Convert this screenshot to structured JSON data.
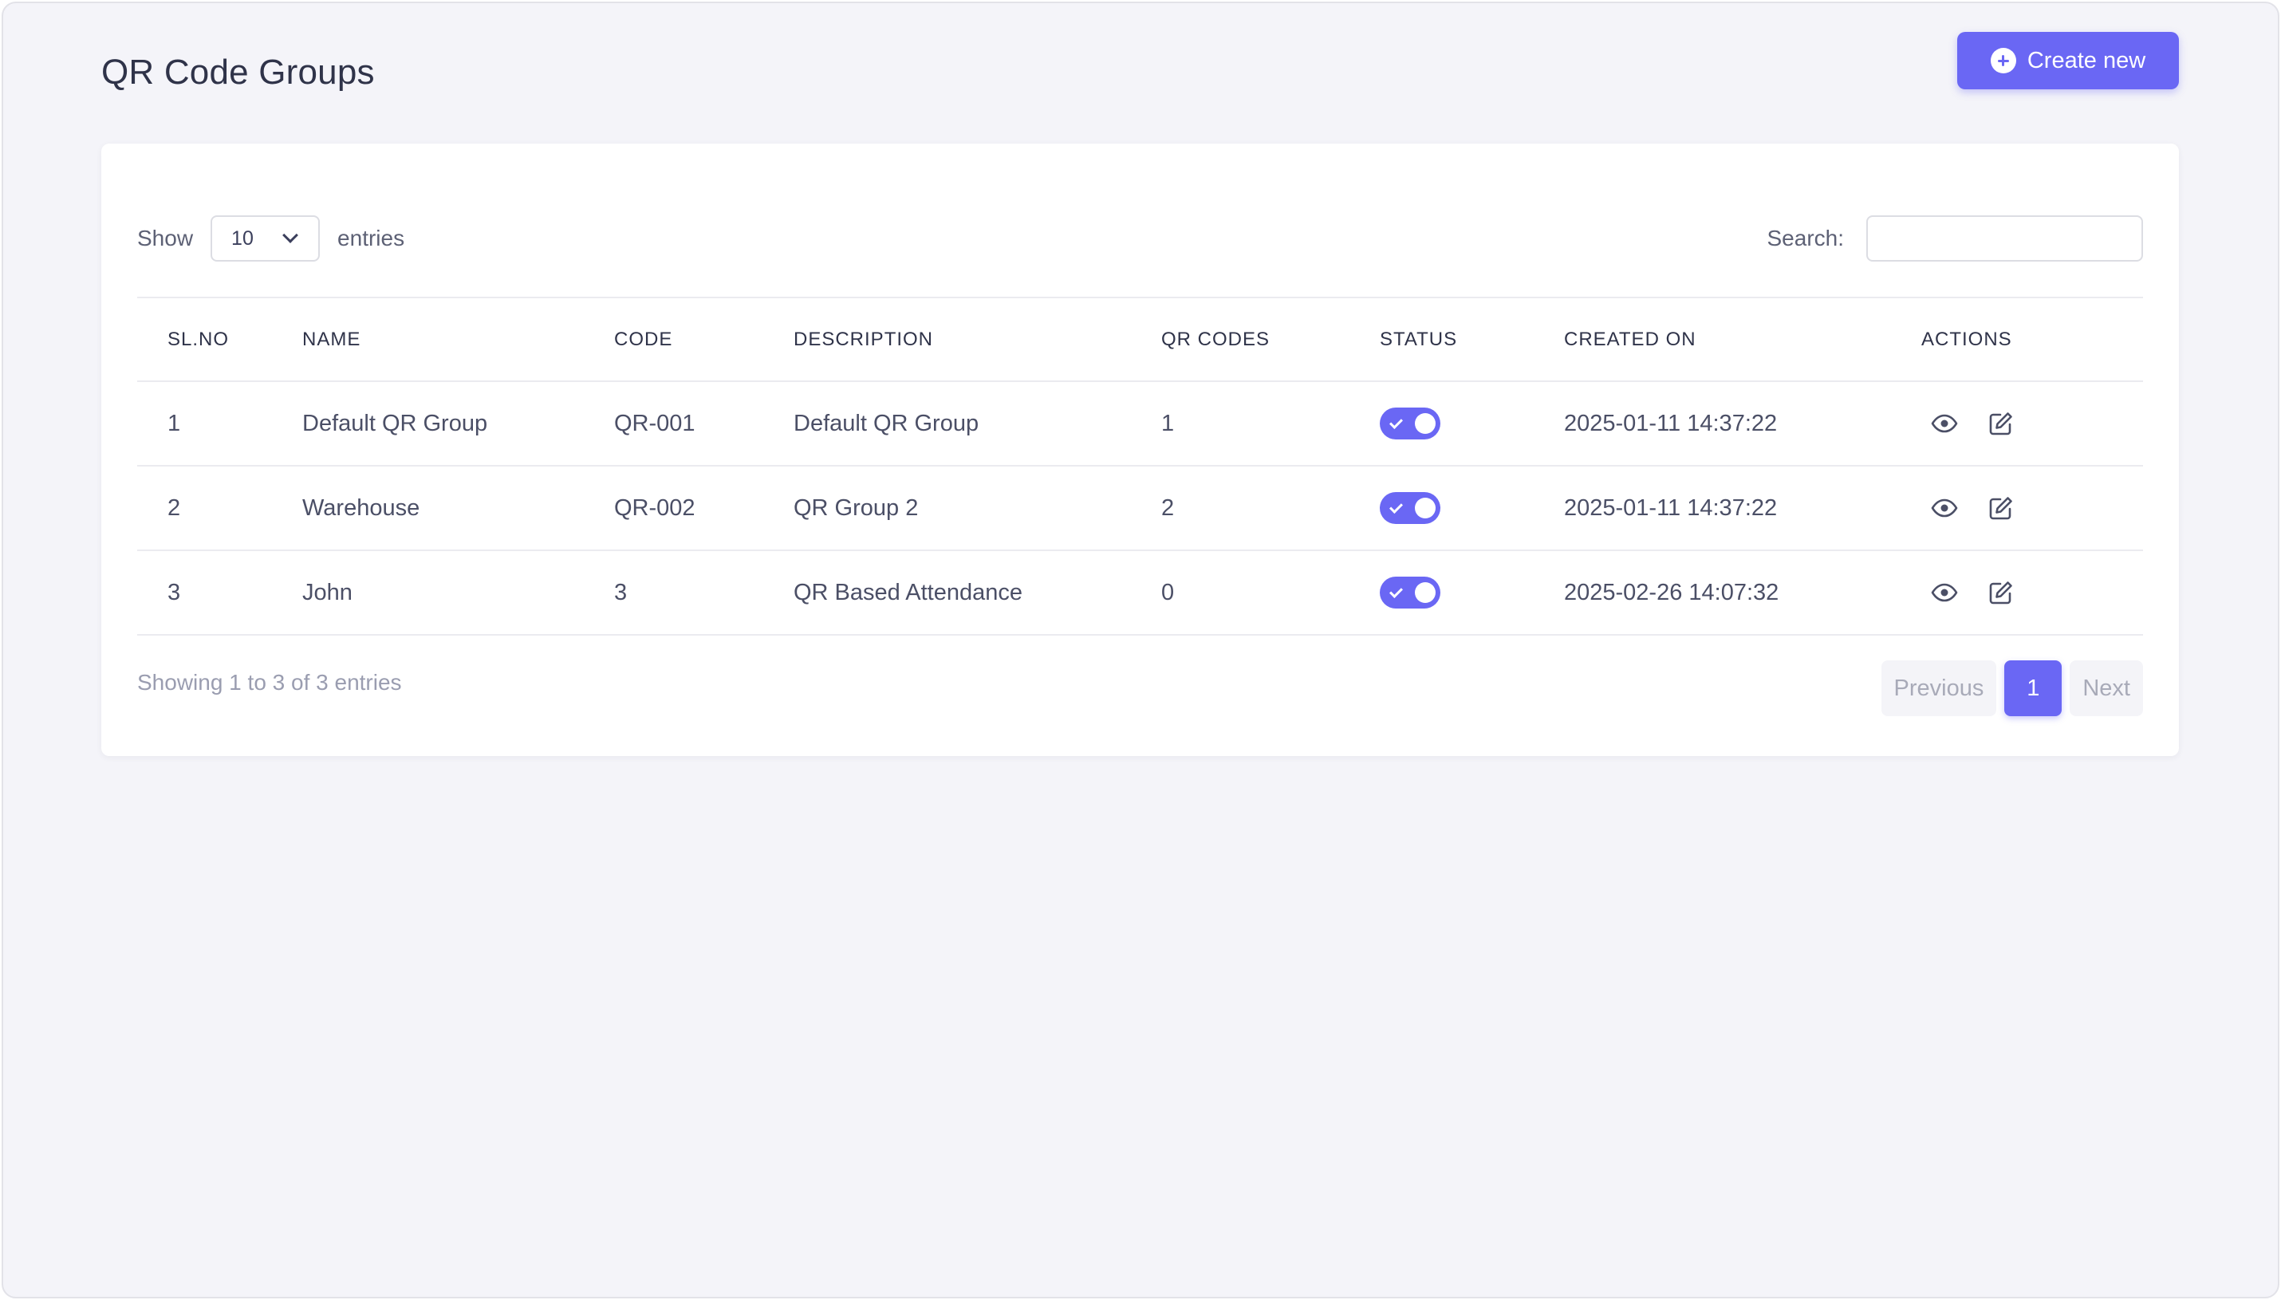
{
  "page": {
    "title": "QR Code Groups",
    "create_label": "Create new"
  },
  "table_controls": {
    "show_label": "Show",
    "entries_value": "10",
    "entries_label": "entries",
    "search_label": "Search:",
    "search_value": ""
  },
  "columns": [
    "SL.NO",
    "NAME",
    "CODE",
    "DESCRIPTION",
    "QR CODES",
    "STATUS",
    "CREATED ON",
    "ACTIONS"
  ],
  "rows": [
    {
      "sl": "1",
      "name": "Default QR Group",
      "code": "QR-001",
      "description": "Default QR Group",
      "qr_codes": "1",
      "status": true,
      "created_on": "2025-01-11 14:37:22"
    },
    {
      "sl": "2",
      "name": "Warehouse",
      "code": "QR-002",
      "description": "QR Group 2",
      "qr_codes": "2",
      "status": true,
      "created_on": "2025-01-11 14:37:22"
    },
    {
      "sl": "3",
      "name": "John",
      "code": "3",
      "description": "QR Based Attendance",
      "qr_codes": "0",
      "status": true,
      "created_on": "2025-02-26 14:07:32"
    }
  ],
  "footer": {
    "info": "Showing 1 to 3 of 3 entries",
    "previous_label": "Previous",
    "current_page": "1",
    "next_label": "Next"
  },
  "icons": {
    "create": "plus-circle-icon",
    "view": "eye-icon",
    "edit": "edit-icon",
    "select": "chevron-down-icon"
  },
  "colors": {
    "accent": "#6a67f4",
    "background": "#f4f4f9",
    "card": "#ffffff"
  }
}
